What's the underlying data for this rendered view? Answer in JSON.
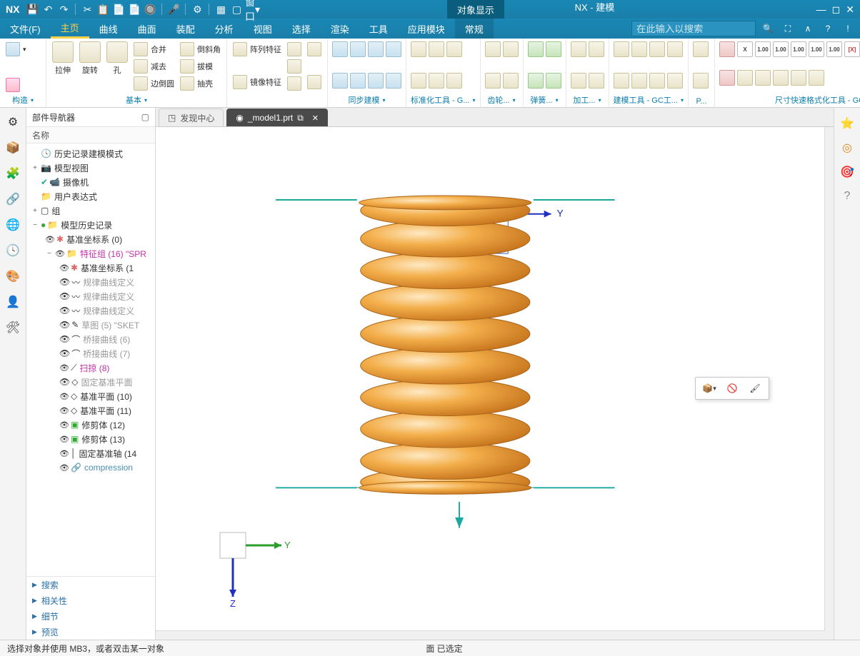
{
  "title_app": "NX",
  "title_highlight": "对象显示",
  "title_doc": "NX - 建模",
  "qat": [
    "💾",
    "↶",
    "↷",
    "✂",
    "📋",
    "📄",
    "📄",
    "🔘",
    "🎤",
    "⚙",
    "▦",
    "▢"
  ],
  "qat_window": "窗口",
  "menu": {
    "items": [
      "文件(F)",
      "主页",
      "曲线",
      "曲面",
      "装配",
      "分析",
      "视图",
      "选择",
      "渲染",
      "工具",
      "应用模块",
      "常规"
    ],
    "active_index": 1
  },
  "search_placeholder": "在此输入以搜索",
  "ribbon_groups": {
    "g0": {
      "label": "构造",
      "items": [
        "",
        ""
      ]
    },
    "g1": {
      "label": "基本",
      "big": [
        "拉伸",
        "旋转",
        "孔"
      ],
      "rows": [
        [
          "合并",
          "倒斜角"
        ],
        [
          "减去",
          "拔模"
        ],
        [
          "边倒圆",
          "抽壳"
        ]
      ]
    },
    "g2": {
      "label": "",
      "rows": [
        [
          "阵列特征"
        ],
        [
          "镜像特征"
        ]
      ]
    },
    "g3": {
      "label": "同步建模"
    },
    "g4": {
      "label": "标准化工具 - G..."
    },
    "g5": {
      "label": "齿轮..."
    },
    "g6": {
      "label": "弹簧..."
    },
    "g7": {
      "label": "加工..."
    },
    "g8": {
      "label": "建模工具 - GC工..."
    },
    "g9": {
      "label": "P..."
    },
    "g10": {
      "label": "尺寸快速格式化工具 - GC工具箱"
    }
  },
  "nav": {
    "title": "部件导航器",
    "col": "名称",
    "tree": {
      "n0": "历史记录建模模式",
      "n1": "模型视图",
      "n2": "摄像机",
      "n3": "用户表达式",
      "n4": "组",
      "n5": "模型历史记录",
      "n6": "基准坐标系 (0)",
      "n7": "特征组 (16) \"SPR",
      "n8": "基准坐标系 (1",
      "n9": "规律曲线定义",
      "n10": "规律曲线定义",
      "n11": "规律曲线定义",
      "n12": "草图 (5) \"SKET",
      "n13": "桥接曲线 (6)",
      "n14": "桥接曲线 (7)",
      "n15": "扫掠 (8)",
      "n16": "固定基准平面",
      "n17": "基准平面 (10)",
      "n18": "基准平面 (11)",
      "n19": "修剪体 (12)",
      "n20": "修剪体 (13)",
      "n21": "固定基准轴 (14",
      "n22": "compression"
    },
    "acc": [
      "搜索",
      "相关性",
      "细节",
      "预览"
    ]
  },
  "tabs": {
    "t0": "发现中心",
    "t1": "_model1.prt"
  },
  "status": {
    "left": "选择对象并使用 MB3，或者双击某一对象",
    "center": "面 已选定"
  },
  "axes": {
    "y": "Y",
    "z": "Z"
  }
}
